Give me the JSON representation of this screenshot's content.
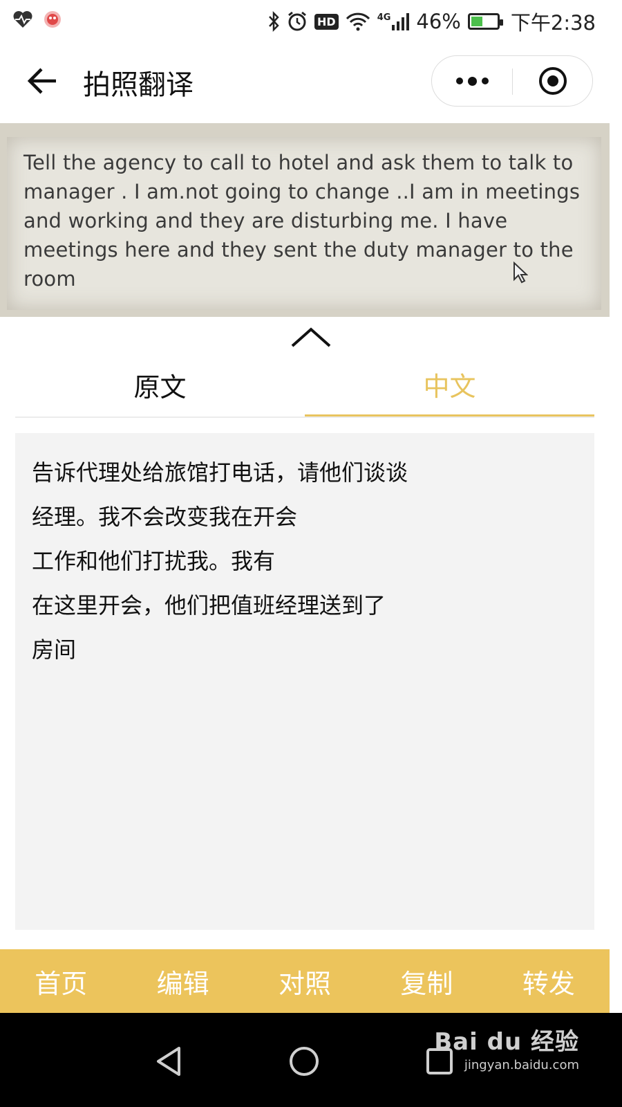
{
  "status_bar": {
    "battery": "46%",
    "battery_level": 0.46,
    "time": "下午2:38",
    "network": "4G",
    "hd": "HD",
    "icons": [
      "health-icon",
      "app-notification-icon",
      "bluetooth-icon",
      "alarm-icon",
      "hd-icon",
      "wifi-icon",
      "signal-icon",
      "battery-icon"
    ]
  },
  "header": {
    "title": "拍照翻译",
    "back_icon": "back-arrow-icon",
    "more_icon": "more-icon",
    "close_icon": "close-miniprogram-icon"
  },
  "photo": {
    "text": "Tell the agency to call to hotel and ask them to talk to manager . I am.not going to change ..I am in meetings and working and they are disturbing me. I have meetings here and they sent the duty manager to the room"
  },
  "tabs": [
    {
      "label": "原文",
      "active": false
    },
    {
      "label": "中文",
      "active": true
    }
  ],
  "result": {
    "lines": [
      "告诉代理处给旅馆打电话，请他们谈谈",
      "经理。我不会改变我在开会",
      "工作和他们打扰我。我有",
      "在这里开会，他们把值班经理送到了",
      "房间"
    ]
  },
  "toolbar": {
    "items": [
      "首页",
      "编辑",
      "对照",
      "复制",
      "转发"
    ]
  },
  "colors": {
    "accent": "#ecc45c",
    "active_tab": "#e8c45e",
    "result_bg": "#f3f3f3"
  },
  "watermark": {
    "main": "Bai du 经验",
    "sub": "jingyan.baidu.com"
  }
}
